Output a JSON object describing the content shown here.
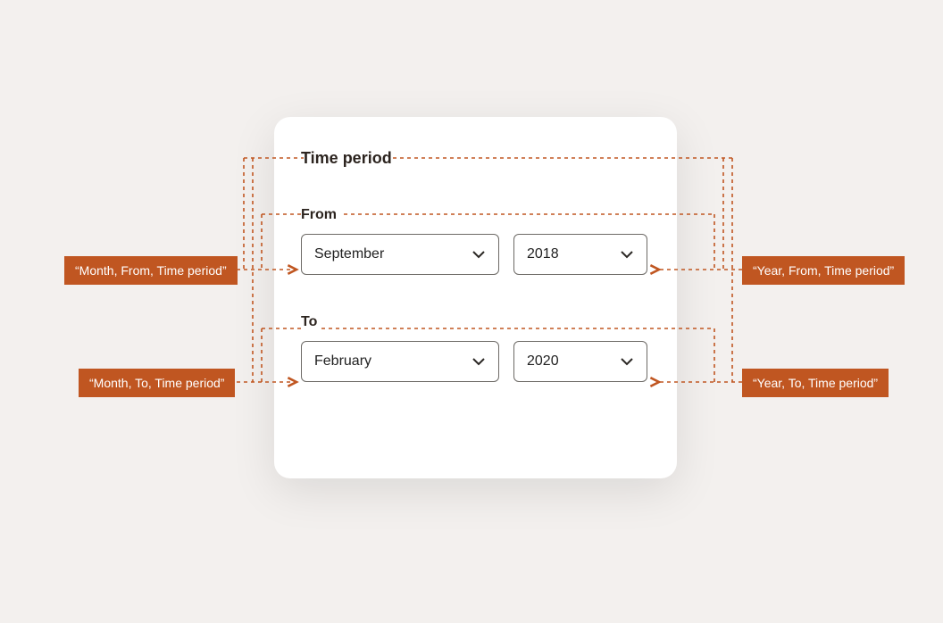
{
  "card": {
    "title": "Time period",
    "from": {
      "label": "From",
      "month": "September",
      "year": "2018"
    },
    "to": {
      "label": "To",
      "month": "February",
      "year": "2020"
    }
  },
  "annotations": {
    "from_month": "“Month, From, Time period”",
    "from_year": "“Year, From, Time period”",
    "to_month": "“Month, To, Time period”",
    "to_year": "“Year, To, Time period”"
  },
  "colors": {
    "accent": "#C05621"
  }
}
